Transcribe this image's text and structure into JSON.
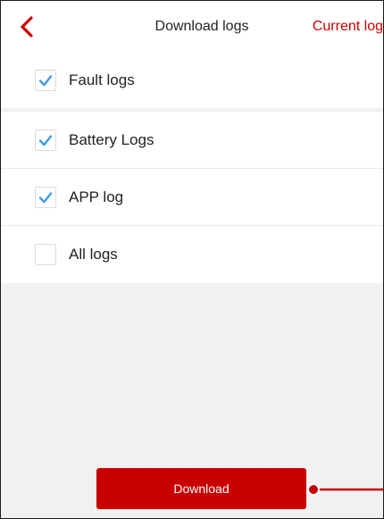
{
  "header": {
    "title": "Download logs",
    "action_label": "Current log"
  },
  "log_options": [
    {
      "label": "Fault logs",
      "checked": true
    },
    {
      "label": "Battery Logs",
      "checked": true
    },
    {
      "label": "APP log",
      "checked": true
    },
    {
      "label": "All logs",
      "checked": false
    }
  ],
  "download_button": {
    "label": "Download"
  },
  "colors": {
    "accent": "#cc0000",
    "check": "#3d9be9",
    "background": "#f1f1f1"
  },
  "icons": {
    "back": "chevron-left-icon",
    "check": "checkmark-icon"
  }
}
